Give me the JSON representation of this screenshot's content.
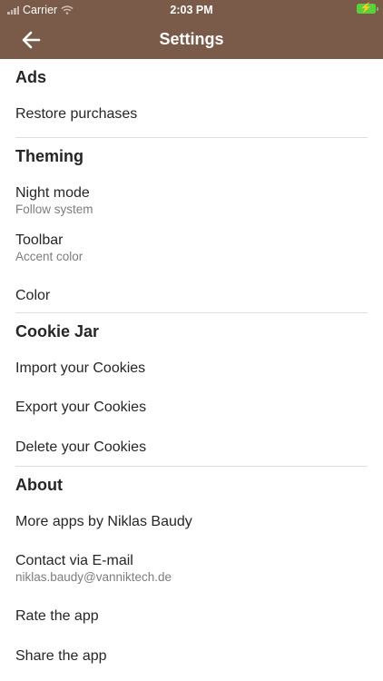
{
  "status": {
    "carrier": "Carrier",
    "time": "2:03 PM"
  },
  "nav": {
    "title": "Settings"
  },
  "ads": {
    "title": "Ads",
    "restore": "Restore purchases"
  },
  "theming": {
    "title": "Theming",
    "night": "Night mode",
    "night_sub": "Follow system",
    "toolbar": "Toolbar",
    "toolbar_sub": "Accent color",
    "color": "Color"
  },
  "cookie": {
    "title": "Cookie Jar",
    "import": "Import your Cookies",
    "export": "Export your Cookies",
    "delete": "Delete your Cookies"
  },
  "about": {
    "title": "About",
    "more": "More apps by Niklas Baudy",
    "contact": "Contact via E-mail",
    "contact_sub": "niklas.baudy@vanniktech.de",
    "rate": "Rate the app",
    "share": "Share the app"
  }
}
